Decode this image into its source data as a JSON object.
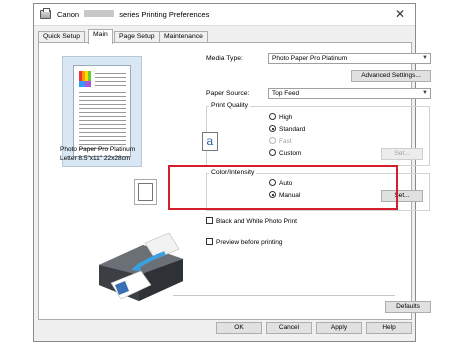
{
  "window": {
    "title_prefix": "Canon",
    "title_suffix": "series Printing Preferences",
    "close_glyph": "✕"
  },
  "tabs": [
    {
      "label": "Quick Setup"
    },
    {
      "label": "Main"
    },
    {
      "label": "Page Setup"
    },
    {
      "label": "Maintenance"
    }
  ],
  "active_tab": "Main",
  "preview": {
    "paper_name": "Photo Paper Pro Platinum",
    "paper_size": "Letter 8.5\"x11\" 22x28cm"
  },
  "media_type": {
    "label": "Media Type:",
    "value": "Photo Paper Pro Platinum"
  },
  "advanced_settings_label": "Advanced Settings...",
  "paper_source": {
    "label": "Paper Source:",
    "value": "Top Feed"
  },
  "print_quality": {
    "title": "Print Quality",
    "icon_glyph": "a",
    "options": [
      {
        "label": "High",
        "checked": false,
        "disabled": false
      },
      {
        "label": "Standard",
        "checked": true,
        "disabled": false
      },
      {
        "label": "Fast",
        "checked": false,
        "disabled": true
      },
      {
        "label": "Custom",
        "checked": false,
        "disabled": false
      }
    ],
    "set_label": "Set..."
  },
  "color_intensity": {
    "title": "Color/Intensity",
    "options": [
      {
        "label": "Auto",
        "checked": false
      },
      {
        "label": "Manual",
        "checked": true
      }
    ],
    "set_label": "Set..."
  },
  "black_white_label": "Black and White Photo Print",
  "preview_before_printing_label": "Preview before printing",
  "defaults_label": "Defaults",
  "footer": {
    "ok": "OK",
    "cancel": "Cancel",
    "apply": "Apply",
    "help": "Help"
  },
  "colors": {
    "highlight": "#d21f2b",
    "preview_bg": "#d9e7f5"
  },
  "icons": {
    "dropdown": "chevron-down-icon",
    "quality": "quality-letter-icon"
  }
}
